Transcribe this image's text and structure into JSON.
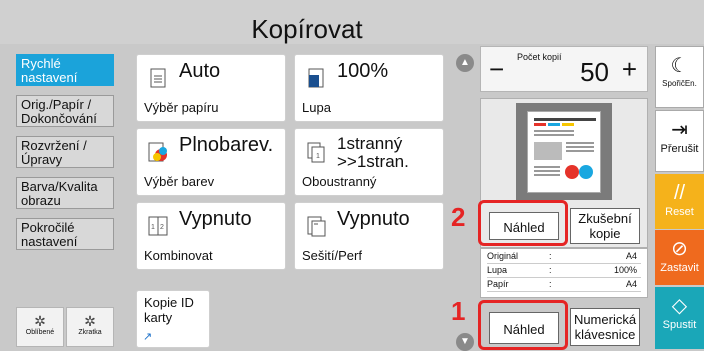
{
  "title": "Kopírovat",
  "side": [
    "Rychlé nastavení",
    "Orig./Papír / Dokončování",
    "Rozvržení /Úpravy",
    "Barva/Kvalita obrazu",
    "Pokročilé nastavení"
  ],
  "fav": {
    "favorites": "Oblíbené",
    "shortcut": "Zkratka"
  },
  "tiles": [
    {
      "value": "Auto",
      "label": "Výběr papíru"
    },
    {
      "value": "100%",
      "label": "Lupa"
    },
    {
      "value": "Plnobarev.",
      "label": "Výběr barev"
    },
    {
      "value": "1stranný >>1stran.",
      "label": "Oboustranný"
    },
    {
      "value": "Vypnuto",
      "label": "Kombinovat"
    },
    {
      "value": "Vypnuto",
      "label": "Sešití/Perf"
    },
    {
      "value": "",
      "label": "Kopie ID karty"
    }
  ],
  "copies": {
    "caption": "Počet kopií",
    "value": "50",
    "minus": "−",
    "plus": "+"
  },
  "preview_btn": "Náhled",
  "test_btn": "Zkušební kopie",
  "preview_btn2": "Náhled",
  "numeric_btn": "Numerická klávesnice",
  "info": [
    {
      "k": "Originál",
      "v": "A4"
    },
    {
      "k": "Lupa",
      "v": "100%"
    },
    {
      "k": "Papír",
      "v": "A4"
    }
  ],
  "right": [
    {
      "label": "SpořičEn.",
      "icon": "☾"
    },
    {
      "label": "Přerušit",
      "icon": "⇥"
    },
    {
      "label": "Reset",
      "icon": "//"
    },
    {
      "label": "Zastavit",
      "icon": "⊘"
    },
    {
      "label": "Spustit",
      "icon": "◇"
    }
  ],
  "callouts": [
    "2",
    "1"
  ],
  "colors": {
    "side_active": "#1ba3da",
    "reset": "#f5b21b",
    "stop": "#ef6a1e",
    "start": "#1aa7b8",
    "callout": "#e52424"
  }
}
